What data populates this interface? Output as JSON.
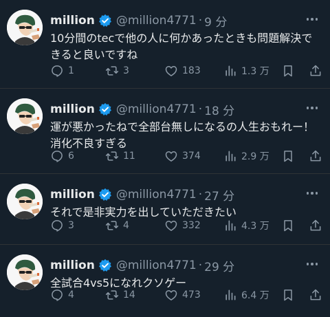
{
  "tweets": [
    {
      "name": "million",
      "handle": "@million4771",
      "dot": "·",
      "time": "9 分",
      "text": "10分間のtecで他の人に何かあったときも問題解決できると良いですね",
      "replies": "1",
      "retweets": "3",
      "likes": "183",
      "views": "1.3 万"
    },
    {
      "name": "million",
      "handle": "@million4771",
      "dot": "·",
      "time": "18 分",
      "text": "運が悪かったねで全部台無しになるの人生おもれー！消化不良すぎる",
      "replies": "6",
      "retweets": "11",
      "likes": "374",
      "views": "2.9 万"
    },
    {
      "name": "million",
      "handle": "@million4771",
      "dot": "·",
      "time": "27 分",
      "text": "それで是非実力を出していただきたい",
      "replies": "3",
      "retweets": "4",
      "likes": "332",
      "views": "4.3 万"
    },
    {
      "name": "million",
      "handle": "@million4771",
      "dot": "·",
      "time": "29 分",
      "text": "全試合4vs5になれクソゲー",
      "replies": "4",
      "retweets": "14",
      "likes": "473",
      "views": "6.4 万"
    }
  ],
  "colors": {
    "background": "#15202b",
    "text": "#e7e9ea",
    "muted": "#8b98a5",
    "verified": "#1d9bf0",
    "divider": "#2f3336"
  },
  "icons": [
    "avatar-icon",
    "verified-badge-icon",
    "more-icon",
    "reply-icon",
    "retweet-icon",
    "like-icon",
    "views-icon",
    "bookmark-icon",
    "share-icon"
  ]
}
